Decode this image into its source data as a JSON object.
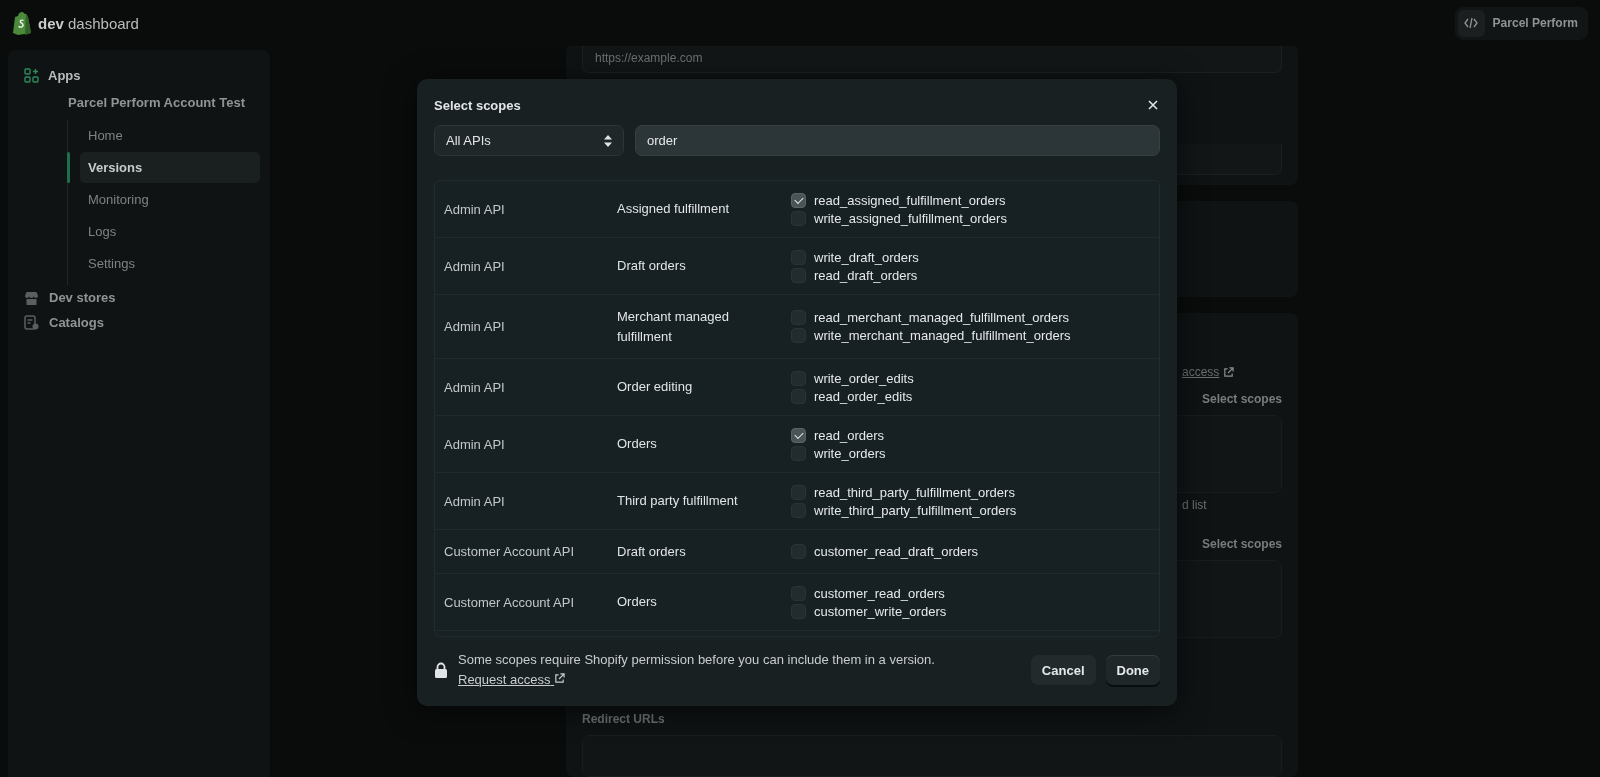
{
  "top_bar": {
    "title": "**dev** dashboard",
    "account": "Parcel Perform"
  },
  "sidebar": {
    "apps_label": "Apps",
    "app_name": "Parcel Perform Account Test",
    "subnav": [
      {
        "label": "Home",
        "selected": false
      },
      {
        "label": "Versions",
        "selected": true
      },
      {
        "label": "Monitoring",
        "selected": false
      },
      {
        "label": "Logs",
        "selected": false
      },
      {
        "label": "Settings",
        "selected": false
      }
    ],
    "other_items": [
      {
        "label": "Dev stores",
        "kind": "store"
      },
      {
        "label": "Catalogs",
        "kind": "catalog"
      }
    ]
  },
  "background": {
    "url_value": "https://example.com",
    "access_link_fragment": "access",
    "select_scopes_links": [
      "Select scopes",
      "Select scopes"
    ],
    "list_fragment": "d list",
    "redirect_label": "Redirect URLs"
  },
  "modal": {
    "title": "Select scopes",
    "api_filter": "All APIs",
    "search_value": "order",
    "rows": [
      {
        "api": "Admin API",
        "resource": "Assigned fulfillment",
        "scopes": [
          {
            "name": "read_assigned_fulfillment_orders",
            "checked": true
          },
          {
            "name": "write_assigned_fulfillment_orders",
            "checked": false
          }
        ]
      },
      {
        "api": "Admin API",
        "resource": "Draft orders",
        "scopes": [
          {
            "name": "write_draft_orders",
            "checked": false
          },
          {
            "name": "read_draft_orders",
            "checked": false
          }
        ]
      },
      {
        "api": "Admin API",
        "resource": "Merchant managed fulfillment",
        "scopes": [
          {
            "name": "read_merchant_managed_fulfillment_orders",
            "checked": false
          },
          {
            "name": "write_merchant_managed_fulfillment_orders",
            "checked": false
          }
        ]
      },
      {
        "api": "Admin API",
        "resource": "Order editing",
        "scopes": [
          {
            "name": "write_order_edits",
            "checked": false
          },
          {
            "name": "read_order_edits",
            "checked": false
          }
        ]
      },
      {
        "api": "Admin API",
        "resource": "Orders",
        "scopes": [
          {
            "name": "read_orders",
            "checked": true
          },
          {
            "name": "write_orders",
            "checked": false
          }
        ]
      },
      {
        "api": "Admin API",
        "resource": "Third party fulfillment",
        "scopes": [
          {
            "name": "read_third_party_fulfillment_orders",
            "checked": false
          },
          {
            "name": "write_third_party_fulfillment_orders",
            "checked": false
          }
        ]
      },
      {
        "api": "Customer Account API",
        "resource": "Draft orders",
        "scopes": [
          {
            "name": "customer_read_draft_orders",
            "checked": false
          }
        ]
      },
      {
        "api": "Customer Account API",
        "resource": "Orders",
        "scopes": [
          {
            "name": "customer_read_orders",
            "checked": false
          },
          {
            "name": "customer_write_orders",
            "checked": false
          }
        ]
      }
    ],
    "notice": "Some scopes require Shopify permission before you can include them in a version.",
    "notice_link": "Request access",
    "buttons": [
      {
        "label": "Cancel",
        "kind": "secondary"
      },
      {
        "label": "Done",
        "kind": "primary"
      }
    ]
  }
}
